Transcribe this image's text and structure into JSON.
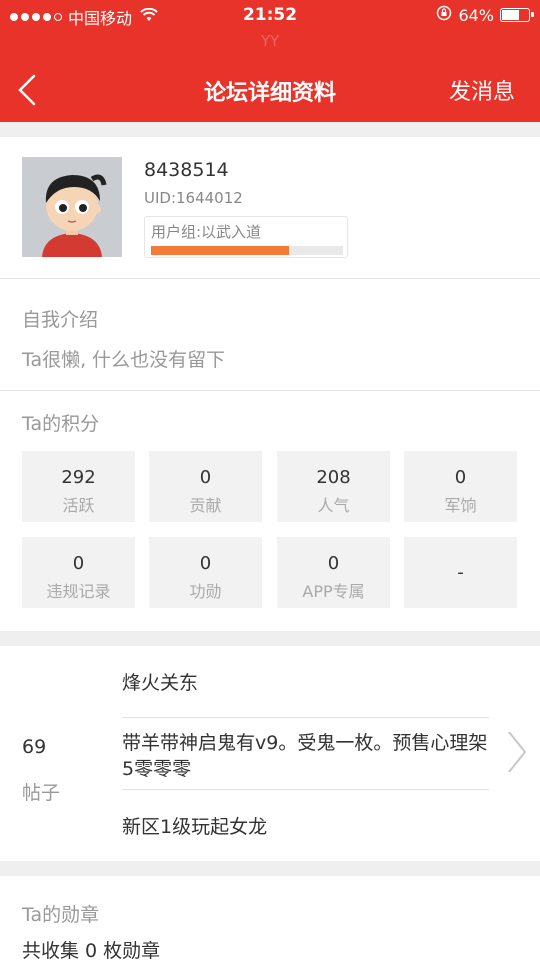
{
  "status_bar": {
    "carrier": "中国移动",
    "time": "21:52",
    "battery": "64%",
    "battery_level": 0.64,
    "ghost_text": "YY"
  },
  "nav": {
    "title": "论坛详细资料",
    "action": "发消息",
    "back_icon": "chevron-left-icon"
  },
  "profile": {
    "username": "8438514",
    "uid": "UID:1644012",
    "group": "用户组:以武入道",
    "group_progress": 0.72
  },
  "intro": {
    "title": "自我介绍",
    "text": "Ta很懒, 什么也没有留下"
  },
  "points": {
    "title": "Ta的积分",
    "items": [
      {
        "value": "292",
        "label": "活跃"
      },
      {
        "value": "0",
        "label": "贡献"
      },
      {
        "value": "208",
        "label": "人气"
      },
      {
        "value": "0",
        "label": "军饷"
      },
      {
        "value": "0",
        "label": "违规记录"
      },
      {
        "value": "0",
        "label": "功勋"
      },
      {
        "value": "0",
        "label": "APP专属"
      },
      {
        "value": "-",
        "label": ""
      }
    ]
  },
  "posts": {
    "count": "69",
    "label": "帖子",
    "items": [
      "烽火关东",
      "带羊带神启鬼有v9。受鬼一枚。预售心理架5零零零",
      "新区1级玩起女龙"
    ]
  },
  "medals": {
    "title": "Ta的勋章",
    "summary": "共收集 0 枚勋章"
  },
  "colors": {
    "brand_red": "#e8332a",
    "progress_orange": "#f47a3a"
  }
}
